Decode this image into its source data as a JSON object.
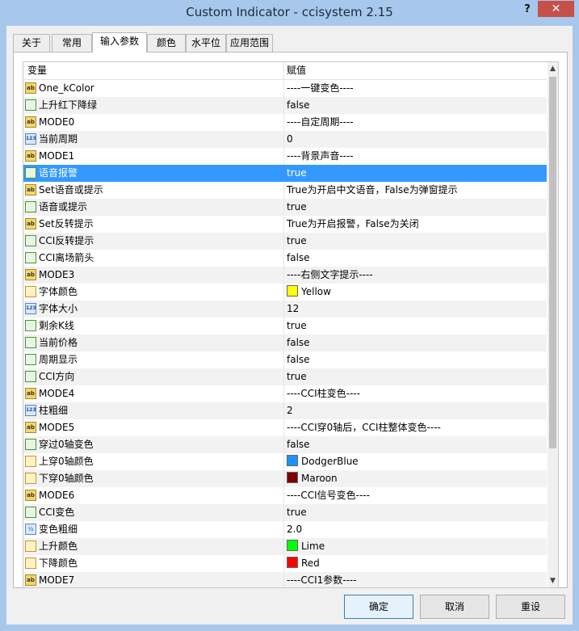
{
  "window": {
    "title": "Custom Indicator - ccisystem 2.15",
    "help": "?",
    "close": "✕"
  },
  "tabs": [
    {
      "label": "关于"
    },
    {
      "label": "常用"
    },
    {
      "label": "输入参数"
    },
    {
      "label": "颜色"
    },
    {
      "label": "水平位"
    },
    {
      "label": "应用范围"
    }
  ],
  "grid": {
    "col_variable": "变量",
    "col_value": "赋值",
    "rows": [
      {
        "icon": "ab",
        "name": "One_kColor",
        "value": "----一键变色----"
      },
      {
        "icon": "bool",
        "name": "上升红下降绿",
        "value": "false"
      },
      {
        "icon": "ab",
        "name": "MODE0",
        "value": "----自定周期----"
      },
      {
        "icon": "123",
        "name": "当前周期",
        "value": "0"
      },
      {
        "icon": "ab",
        "name": "MODE1",
        "value": "----背景声音----"
      },
      {
        "icon": "bool",
        "name": "语音报警",
        "value": "true",
        "selected": true
      },
      {
        "icon": "ab",
        "name": "Set语音或提示",
        "value": "True为开启中文语音，False为弹窗提示"
      },
      {
        "icon": "bool",
        "name": "语音或提示",
        "value": "true"
      },
      {
        "icon": "ab",
        "name": "Set反转提示",
        "value": "True为开启报警，False为关闭"
      },
      {
        "icon": "bool",
        "name": "CCI反转提示",
        "value": "true"
      },
      {
        "icon": "bool",
        "name": "CCI离场箭头",
        "value": "false"
      },
      {
        "icon": "ab",
        "name": "MODE3",
        "value": "----右侧文字提示----"
      },
      {
        "icon": "color",
        "name": "字体颜色",
        "value": "Yellow",
        "swatch": "#ffff00"
      },
      {
        "icon": "123",
        "name": "字体大小",
        "value": "12"
      },
      {
        "icon": "bool",
        "name": "剩余K线",
        "value": "true"
      },
      {
        "icon": "bool",
        "name": "当前价格",
        "value": "false"
      },
      {
        "icon": "bool",
        "name": "周期显示",
        "value": "false"
      },
      {
        "icon": "bool",
        "name": "CCI方向",
        "value": "true"
      },
      {
        "icon": "ab",
        "name": "MODE4",
        "value": "----CCI柱变色----"
      },
      {
        "icon": "123",
        "name": "柱粗细",
        "value": "2"
      },
      {
        "icon": "ab",
        "name": "MODE5",
        "value": "----CCI穿0轴后，CCI柱整体变色----"
      },
      {
        "icon": "bool",
        "name": "穿过0轴变色",
        "value": "false"
      },
      {
        "icon": "color",
        "name": "上穿0轴颜色",
        "value": "DodgerBlue",
        "swatch": "#1e90ff"
      },
      {
        "icon": "color",
        "name": "下穿0轴颜色",
        "value": "Maroon",
        "swatch": "#800000"
      },
      {
        "icon": "ab",
        "name": "MODE6",
        "value": "----CCI信号变色----"
      },
      {
        "icon": "bool",
        "name": "CCI变色",
        "value": "true"
      },
      {
        "icon": "half",
        "name": "变色粗细",
        "value": "2.0"
      },
      {
        "icon": "color",
        "name": "上升颜色",
        "value": "Lime",
        "swatch": "#00ff00"
      },
      {
        "icon": "color",
        "name": "下降颜色",
        "value": "Red",
        "swatch": "#ff0000"
      },
      {
        "icon": "ab",
        "name": "MODE7",
        "value": "----CCI1参数----"
      }
    ]
  },
  "buttons": {
    "ok": "确定",
    "cancel": "取消",
    "reset": "重设"
  },
  "colors": {
    "selection": "#3399ff",
    "title_bar": "#a7c7ec",
    "close": "#c7504a"
  }
}
